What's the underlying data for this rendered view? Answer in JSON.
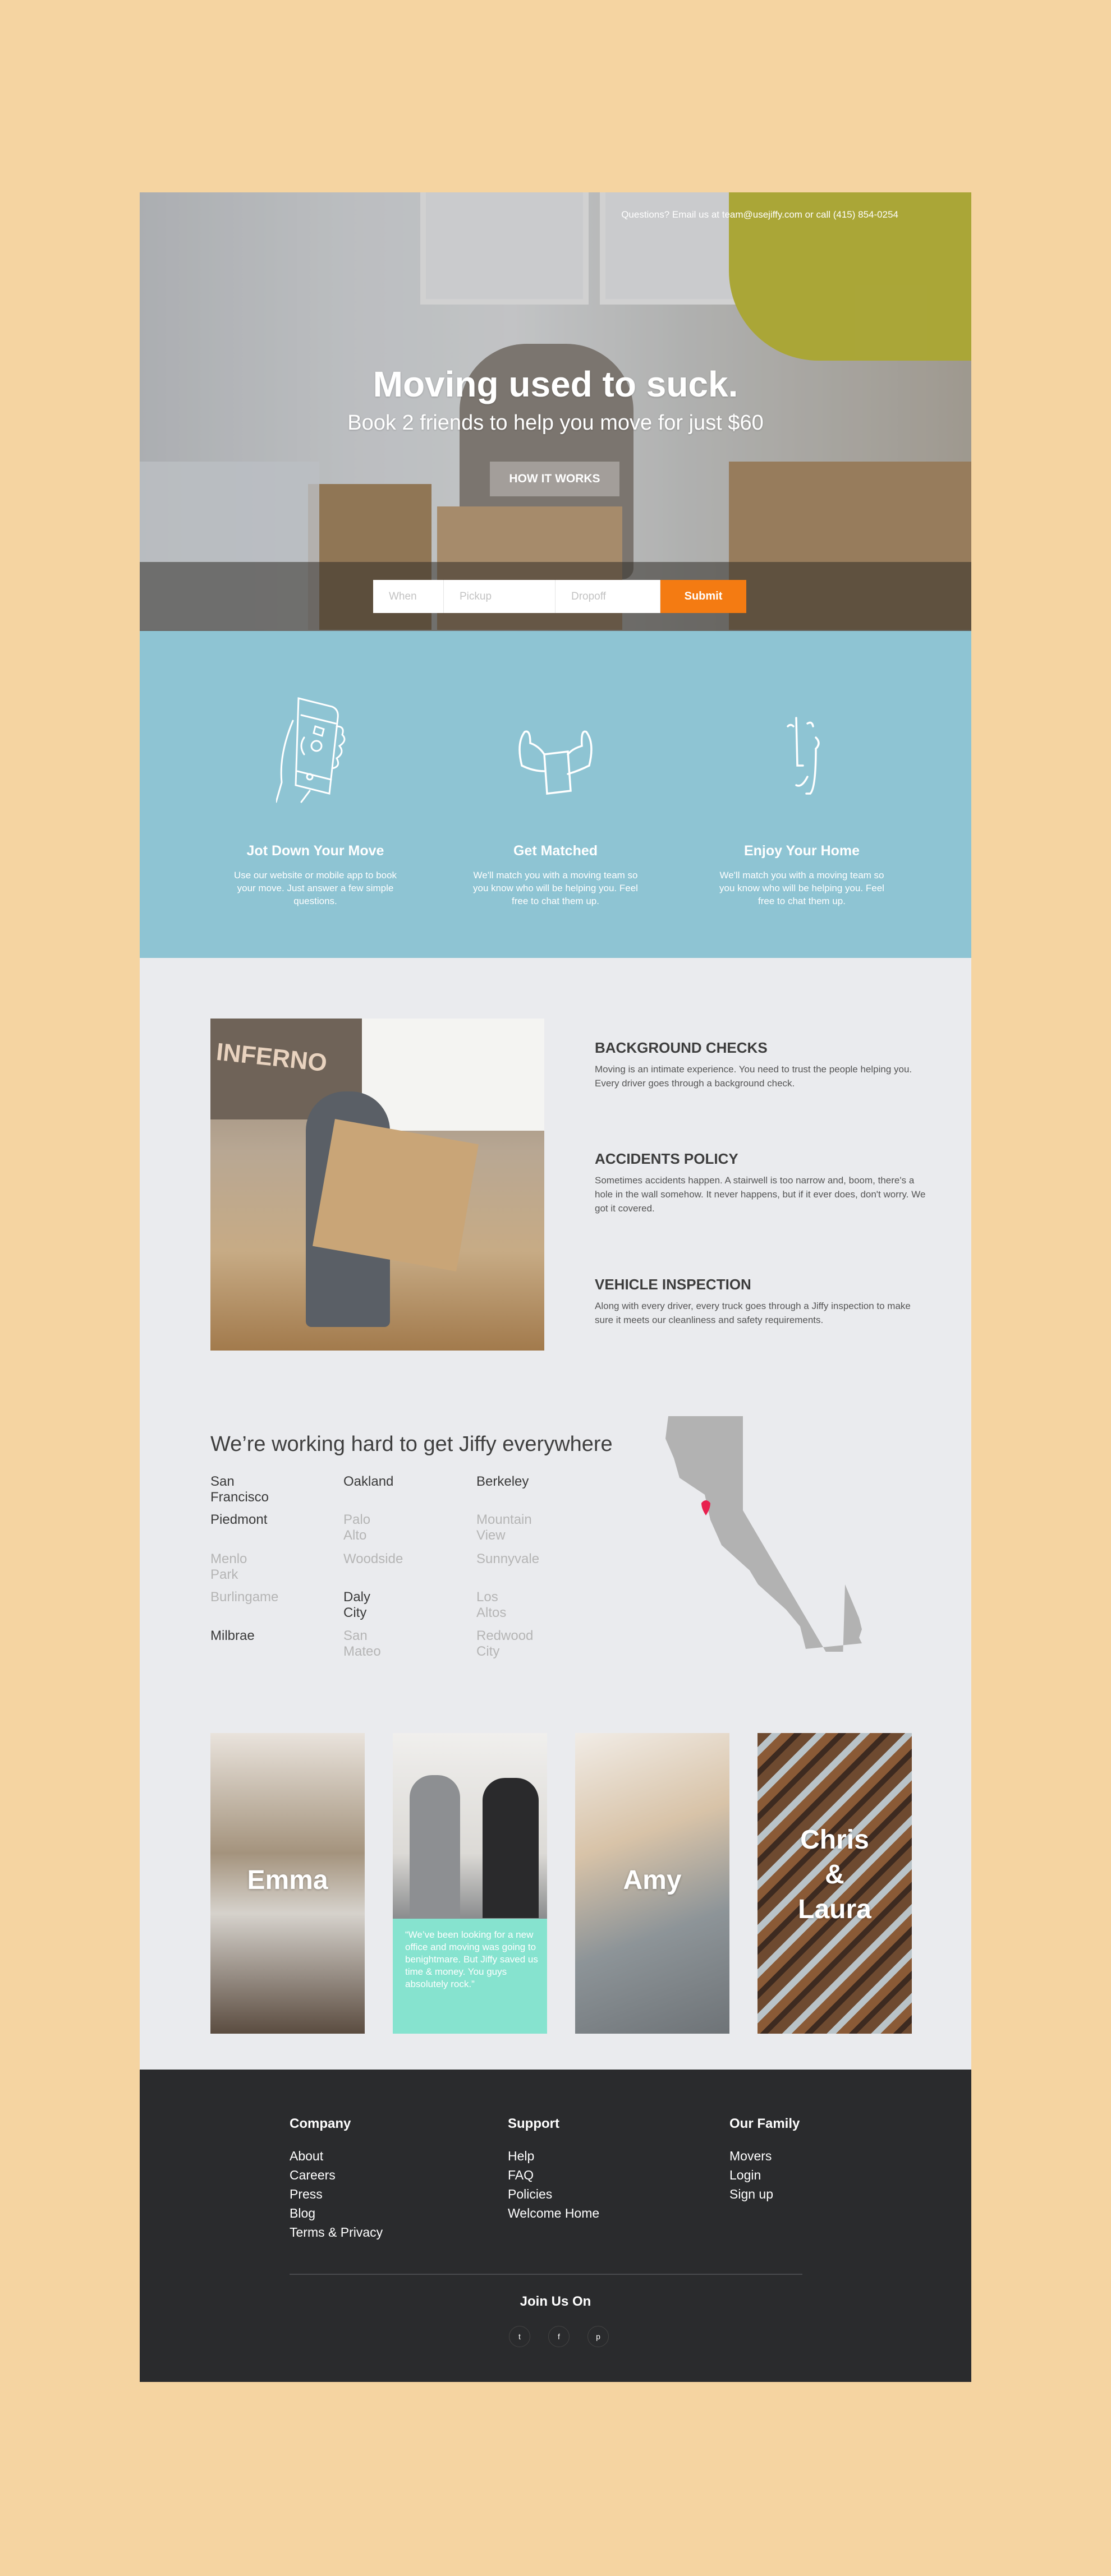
{
  "hero": {
    "contact": "Questions? Email us at team@usejiffy.com or call (415) 854-0254",
    "headline": "Moving used to suck.",
    "subheadline": "Book 2 friends to help you move for just $60",
    "how_button": "HOW IT WORKS",
    "form": {
      "when_placeholder": "When",
      "pickup_placeholder": "Pickup",
      "dropoff_placeholder": "Dropoff",
      "submit": "Submit"
    }
  },
  "steps": [
    {
      "icon": "phone-hand-icon",
      "title": "Jot Down Your Move",
      "text": "Use our website or mobile app to book your move. Just answer a few simple questions."
    },
    {
      "icon": "flexing-arms-icon",
      "title": "Get Matched",
      "text": "We'll match you with a moving team so you know who will be helping you. Feel free to chat them up."
    },
    {
      "icon": "smiley-face-icon",
      "title": "Enjoy Your Home",
      "text": "We'll match you with a moving team so you know who will be helping you. Feel free to chat them up."
    }
  ],
  "features": [
    {
      "title": "BACKGROUND CHECKS",
      "text": "Moving is an intimate experience. You need to trust the people helping you. Every driver goes through a background check."
    },
    {
      "title": "ACCIDENTS POLICY",
      "text": "Sometimes accidents happen. A stairwell is too narrow and, boom, there's a hole in the wall somehow. It never happens, but if it ever does, don't worry. We got it covered."
    },
    {
      "title": "VEHICLE INSPECTION",
      "text": "Along with every driver, every truck goes through a Jiffy inspection to make sure it meets our cleanliness and safety requirements."
    }
  ],
  "photo_sign": "INFERNO",
  "cities": {
    "title": "We’re working hard to get Jiffy everywhere",
    "columns": [
      [
        {
          "name": "San Francisco",
          "active": true
        },
        {
          "name": "Piedmont",
          "active": true
        },
        {
          "name": "Menlo Park",
          "active": false
        },
        {
          "name": "Burlingame",
          "active": false
        },
        {
          "name": "Milbrae",
          "active": true
        }
      ],
      [
        {
          "name": "Oakland",
          "active": true
        },
        {
          "name": "Palo Alto",
          "active": false
        },
        {
          "name": "Woodside",
          "active": false
        },
        {
          "name": "Daly City",
          "active": true
        },
        {
          "name": "San Mateo",
          "active": false
        }
      ],
      [
        {
          "name": "Berkeley",
          "active": true
        },
        {
          "name": "Mountain View",
          "active": false
        },
        {
          "name": "Sunnyvale",
          "active": false
        },
        {
          "name": "Los Altos",
          "active": false
        },
        {
          "name": "Redwood City",
          "active": false
        }
      ]
    ],
    "active_color": "#3a3a3a",
    "inactive_color": "#b5b5b5",
    "map_color": "#B2B2B2",
    "pin_color": "#E8214F"
  },
  "people": {
    "cards": [
      {
        "name": "Emma"
      },
      {
        "name": ""
      },
      {
        "name": "Amy"
      },
      {
        "name": "Chris\n&\nLaura"
      }
    ],
    "quote": "“We’ve been looking for a new office and moving was going to benightmare. But Jiffy saved us time & money. You guys absolutely rock.”"
  },
  "footer": {
    "columns": [
      {
        "title": "Company",
        "links": [
          "About",
          "Careers",
          "Press",
          "Blog",
          "Terms & Privacy"
        ]
      },
      {
        "title": "Support",
        "links": [
          "Help",
          "FAQ",
          "Policies",
          "Welcome Home"
        ]
      },
      {
        "title": "Our Family",
        "links": [
          "Movers",
          "Login",
          "Sign up"
        ]
      }
    ],
    "join": "Join Us On",
    "social": [
      {
        "icon": "twitter-icon",
        "glyph": "t"
      },
      {
        "icon": "facebook-icon",
        "glyph": "f"
      },
      {
        "icon": "pinterest-icon",
        "glyph": "p"
      }
    ]
  },
  "colors": {
    "accent": "#F47B12",
    "steps_bg": "#8EC4D3",
    "quote_bg": "#86E3CF",
    "footer_bg": "#2A2B2D",
    "page_bg": "#F5D4A1"
  }
}
